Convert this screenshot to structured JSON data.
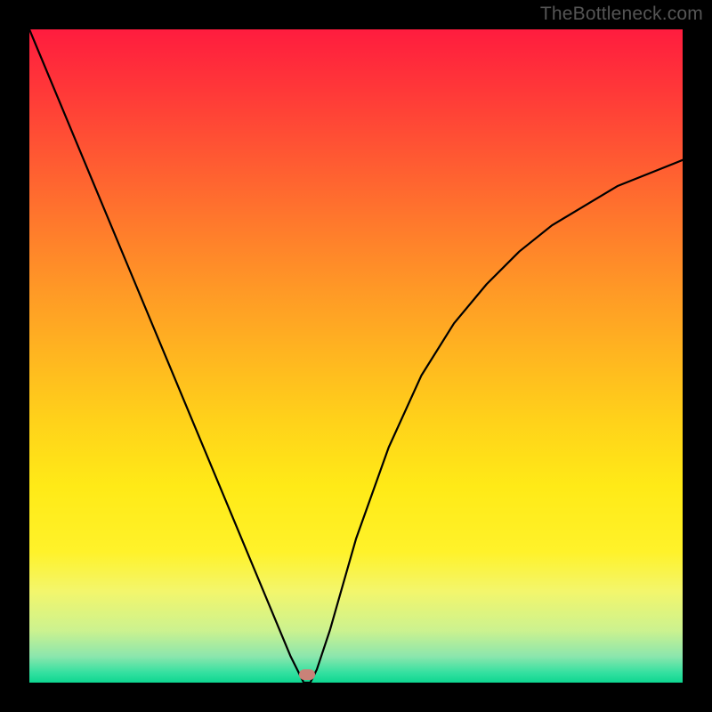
{
  "attribution": "TheBottleneck.com",
  "chart_data": {
    "type": "line",
    "title": "",
    "xlabel": "",
    "ylabel": "",
    "xlim": [
      0,
      100
    ],
    "ylim": [
      0,
      100
    ],
    "grid": false,
    "series": [
      {
        "name": "bottleneck-curve",
        "x": [
          0,
          5,
          10,
          15,
          20,
          25,
          30,
          35,
          40,
          42,
          43,
          44,
          46,
          50,
          55,
          60,
          65,
          70,
          75,
          80,
          85,
          90,
          95,
          100
        ],
        "values": [
          100,
          88,
          76,
          64,
          52,
          40,
          28,
          16,
          4,
          0,
          0,
          2,
          8,
          22,
          36,
          47,
          55,
          61,
          66,
          70,
          73,
          76,
          78,
          80
        ]
      }
    ],
    "marker": {
      "x": 42.5,
      "y": 1.2
    },
    "background_gradient_stops": [
      {
        "pos": 0,
        "color": "#ff1c3e"
      },
      {
        "pos": 0.5,
        "color": "#ffb620"
      },
      {
        "pos": 0.86,
        "color": "#f3f66c"
      },
      {
        "pos": 1.0,
        "color": "#0ed690"
      }
    ]
  }
}
